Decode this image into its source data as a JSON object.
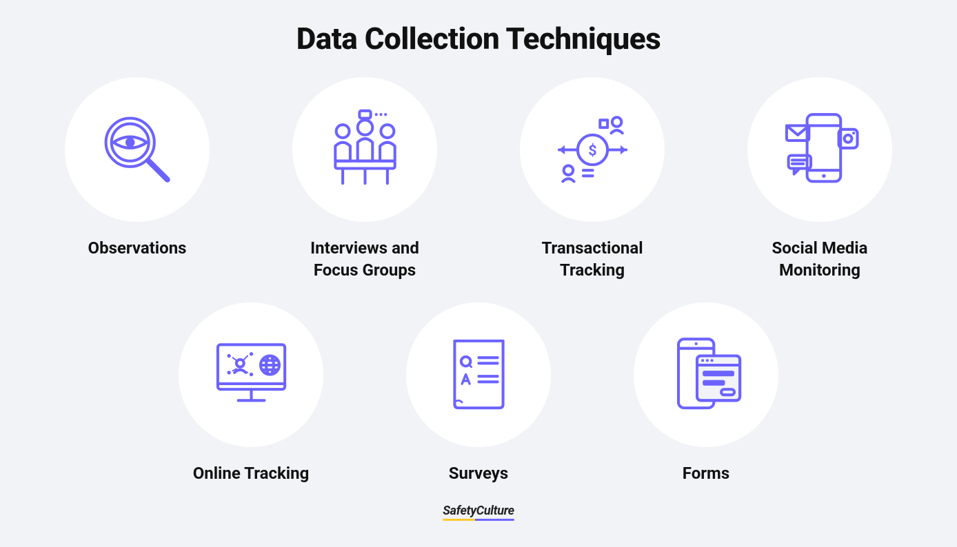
{
  "title": "Data Collection Techniques",
  "items": [
    {
      "label": "Observations",
      "icon": "observations-icon"
    },
    {
      "label": "Interviews and\nFocus Groups",
      "icon": "interviews-icon"
    },
    {
      "label": "Transactional\nTracking",
      "icon": "transactional-icon"
    },
    {
      "label": "Social Media\nMonitoring",
      "icon": "social-media-icon"
    },
    {
      "label": "Online Tracking",
      "icon": "online-tracking-icon"
    },
    {
      "label": "Surveys",
      "icon": "surveys-icon"
    },
    {
      "label": "Forms",
      "icon": "forms-icon"
    }
  ],
  "footer": "SafetyCulture",
  "colors": {
    "accent": "#6c63ff",
    "background": "#f2f3f7",
    "circle": "#ffffff",
    "text": "#111111"
  }
}
